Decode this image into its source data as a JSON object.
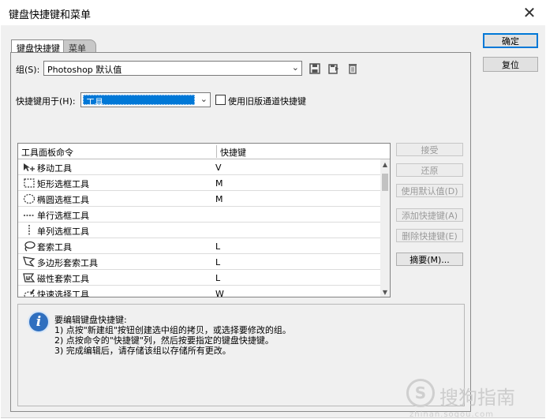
{
  "window": {
    "title": "键盘快捷键和菜单",
    "close_glyph": "✕"
  },
  "side_buttons": {
    "ok": "确定",
    "reset": "复位"
  },
  "tabs": [
    {
      "label": "键盘快捷键"
    },
    {
      "label": "菜单"
    }
  ],
  "set": {
    "label": "组(S):",
    "value": "Photoshop 默认值"
  },
  "shortcuts_for": {
    "label": "快捷键用于(H):",
    "value": "工具"
  },
  "legacy_checkbox": {
    "label": "使用旧版通道快捷键",
    "checked": false
  },
  "table": {
    "headers": {
      "command": "工具面板命令",
      "shortcut": "快捷键"
    },
    "rows": [
      {
        "command": "移动工具",
        "shortcut": "V",
        "icon": "move-tool-icon"
      },
      {
        "command": "矩形选框工具",
        "shortcut": "M",
        "icon": "rect-marquee-icon"
      },
      {
        "command": "椭圆选框工具",
        "shortcut": "M",
        "icon": "ellipse-marquee-icon"
      },
      {
        "command": "单行选框工具",
        "shortcut": "",
        "icon": "single-row-marquee-icon"
      },
      {
        "command": "单列选框工具",
        "shortcut": "",
        "icon": "single-column-marquee-icon"
      },
      {
        "command": "套索工具",
        "shortcut": "L",
        "icon": "lasso-icon"
      },
      {
        "command": "多边形套索工具",
        "shortcut": "L",
        "icon": "polygon-lasso-icon"
      },
      {
        "command": "磁性套索工具",
        "shortcut": "L",
        "icon": "magnetic-lasso-icon"
      },
      {
        "command": "快速选择工具",
        "shortcut": "W",
        "icon": "quick-selection-icon"
      }
    ]
  },
  "right_buttons": {
    "accept": "接受",
    "undo": "还原",
    "use_default": "使用默认值(D)",
    "add_shortcut": "添加快捷键(A)",
    "delete_shortcut": "删除快捷键(E)",
    "summarize": "摘要(M)..."
  },
  "info": {
    "lines": [
      "要编辑键盘快捷键:",
      "1) 点按\"新建组\"按钮创建选中组的拷贝，或选择要修改的组。",
      "2) 点按命令的\"快捷键\"列，然后按要指定的键盘快捷键。",
      "3) 完成编辑后，请存储该组以存储所有更改。"
    ]
  },
  "watermark": {
    "logo_glyph": "S",
    "text": "搜狗指南",
    "url": "zhinan.sogou.com"
  },
  "colors": {
    "selection": "#0078d7",
    "panel": "#f0f0f0",
    "info_icon": "#2f6fbf"
  }
}
